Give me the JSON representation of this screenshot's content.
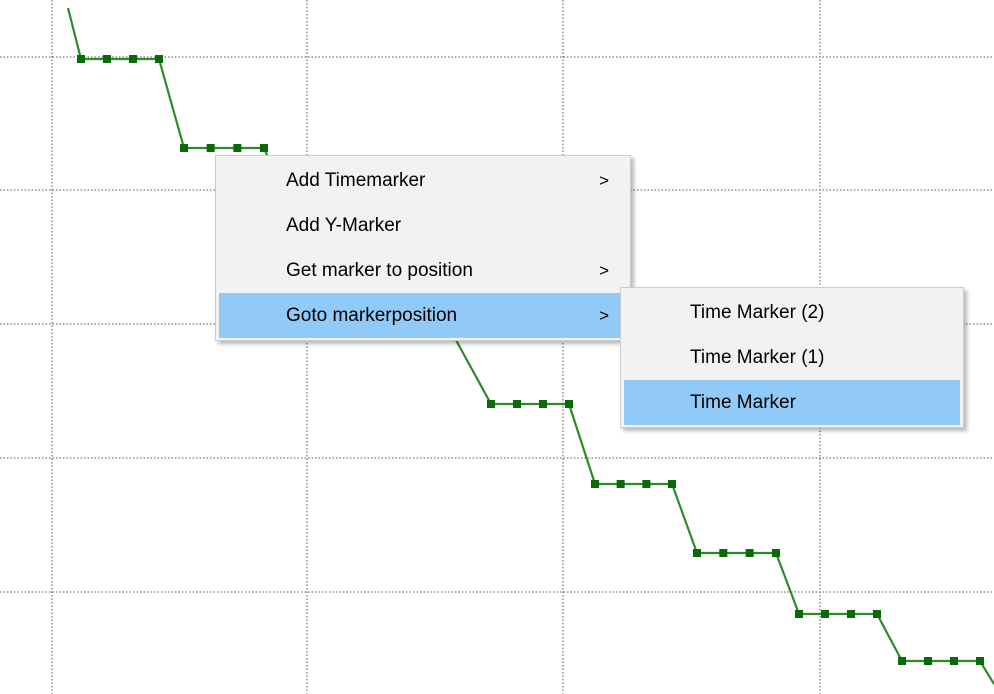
{
  "chart_data": {
    "type": "line",
    "xlabel": "",
    "ylabel": "",
    "grid": true,
    "gridline_style": "dotted",
    "series_color": "#2d8a2d",
    "marker_color": "#0a6a0a",
    "steps": [
      {
        "level": 0,
        "marker_count": 4
      },
      {
        "level": 1,
        "marker_count": 4
      },
      {
        "level": 2,
        "marker_count": 0
      },
      {
        "level": 3,
        "marker_count": 0
      },
      {
        "level": 4,
        "marker_count": 4
      },
      {
        "level": 5,
        "marker_count": 4
      },
      {
        "level": 6,
        "marker_count": 4
      },
      {
        "level": 7,
        "marker_count": 4
      },
      {
        "level": 8,
        "marker_count": 4
      }
    ]
  },
  "context_menu": {
    "items": [
      {
        "label": "Add Timemarker",
        "has_submenu": true,
        "highlighted": false
      },
      {
        "label": "Add Y-Marker",
        "has_submenu": false,
        "highlighted": false
      },
      {
        "label": "Get marker to position",
        "has_submenu": true,
        "highlighted": false
      },
      {
        "label": "Goto markerposition",
        "has_submenu": true,
        "highlighted": true
      }
    ],
    "submenu_arrow": ">",
    "highlight_color": "#91c9f7"
  },
  "submenu": {
    "items": [
      {
        "label": "Time Marker (2)",
        "highlighted": false
      },
      {
        "label": "Time Marker (1)",
        "highlighted": false
      },
      {
        "label": "Time Marker",
        "highlighted": true
      }
    ]
  }
}
